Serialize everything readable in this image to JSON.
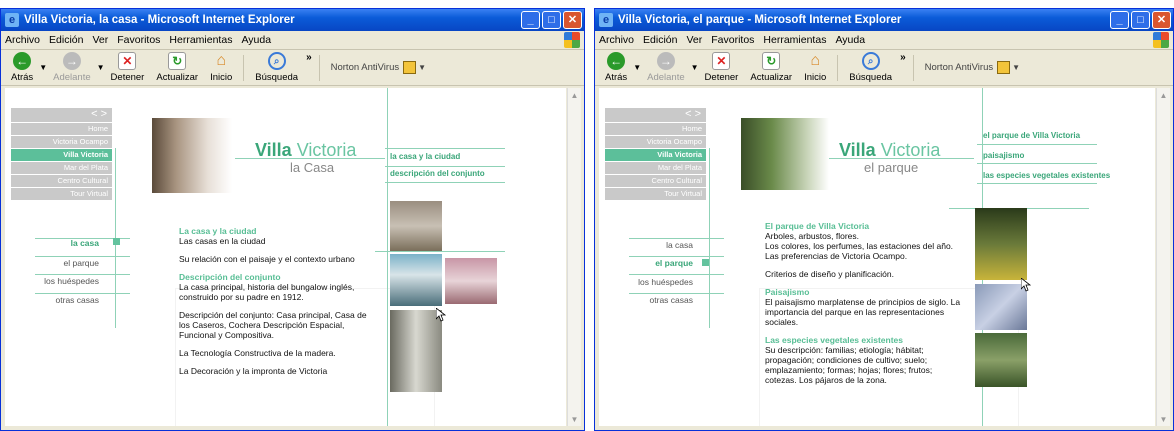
{
  "window1": {
    "title": "Villa Victoria, la casa - Microsoft Internet Explorer",
    "menu": [
      "Archivo",
      "Edición",
      "Ver",
      "Favoritos",
      "Herramientas",
      "Ayuda"
    ],
    "toolbar": {
      "back": "Atrás",
      "forward": "Adelante",
      "stop": "Detener",
      "refresh": "Actualizar",
      "home": "Inicio",
      "search": "Búsqueda",
      "norton": "Norton AntiVirus"
    },
    "nav": [
      "Home",
      "Victoria Ocampo",
      "Villa Victoria",
      "Mar del Plata",
      "Centro Cultural",
      "Tour Virtual"
    ],
    "nav_active": "Villa Victoria",
    "subnav": [
      "la casa",
      "el parque",
      "los huéspedes",
      "otras casas"
    ],
    "logo": {
      "bold": "Villa",
      "light": "Victoria",
      "sub": "la Casa"
    },
    "right_links": [
      "la casa y la ciudad",
      "descripción del conjunto"
    ],
    "sections": [
      {
        "heading": "La casa y la ciudad",
        "paras": [
          "Las casas en la ciudad",
          "Su relación con el paisaje y el contexto urbano"
        ]
      },
      {
        "heading": "Descripción del conjunto",
        "paras": [
          "La casa principal, historia del bungalow inglés, construido por su padre en 1912.",
          "Descripción del conjunto: Casa principal, Casa de los Caseros, Cochera Descripción Espacial, Funcional y Compositiva.",
          "La Tecnología Constructiva de la madera.",
          "La Decoración y la impronta de Victoria"
        ]
      }
    ]
  },
  "window2": {
    "title": "Villa Victoria, el parque - Microsoft Internet Explorer",
    "menu": [
      "Archivo",
      "Edición",
      "Ver",
      "Favoritos",
      "Herramientas",
      "Ayuda"
    ],
    "toolbar": {
      "back": "Atrás",
      "forward": "Adelante",
      "stop": "Detener",
      "refresh": "Actualizar",
      "home": "Inicio",
      "search": "Búsqueda",
      "norton": "Norton AntiVirus"
    },
    "nav": [
      "Home",
      "Victoria Ocampo",
      "Villa Victoria",
      "Mar del Plata",
      "Centro Cultural",
      "Tour Virtual"
    ],
    "nav_active": "Villa Victoria",
    "subnav": [
      "la casa",
      "el parque",
      "los huéspedes",
      "otras casas"
    ],
    "logo": {
      "bold": "Villa",
      "light": "Victoria",
      "sub": "el parque"
    },
    "right_links": [
      "el parque de Villa Victoria",
      "paisajismo",
      "las especies vegetales existentes"
    ],
    "sections": [
      {
        "heading": "El parque de Villa Victoria",
        "paras": [
          "Arboles, arbustos, flores.",
          "Los colores, los perfumes, las estaciones del año. Las preferencias de Victoria Ocampo.",
          "Criterios de diseño y planificación."
        ]
      },
      {
        "heading": "Paisajismo",
        "paras": [
          "El paisajismo marplatense de principios de siglo. La importancia del parque en las representaciones sociales."
        ]
      },
      {
        "heading": "Las especies vegetales existentes",
        "paras": [
          "Su descripción: familias; etiología; hábitat; propagación; condiciones de cultivo; suelo; emplazamiento; formas; hojas; flores; frutos; cotezas. Los pájaros de la zona."
        ]
      }
    ]
  }
}
